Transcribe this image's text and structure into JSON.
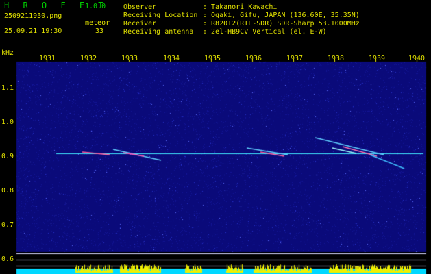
{
  "header": {
    "app_name": "H R O F F T",
    "app_version": "1.0.0",
    "file_name": "2509211930.png",
    "datetime": "25.09.21 19:30",
    "meteor_label": "meteor",
    "meteor_count": "33"
  },
  "info": [
    {
      "label": "Observer",
      "value": ": Takanori Kawachi"
    },
    {
      "label": "Receiving Location",
      "value": ": Ogaki, Gifu, JAPAN (136.60E, 35.35N)"
    },
    {
      "label": "Receiver",
      "value": ": R820T2(RTL-SDR) SDR-Sharp 53.1000MHz"
    },
    {
      "label": "Receiving antenna",
      "value": ": 2el-HB9CV Vertical (el. E-W)"
    }
  ],
  "axis": {
    "y_unit": "kHz",
    "x_ticks": [
      "1931",
      "1932",
      "1933",
      "1934",
      "1935",
      "1936",
      "1937",
      "1938",
      "1939",
      "1940"
    ],
    "y_ticks": [
      "1.1",
      "1.0",
      "0.9",
      "0.8",
      "0.7",
      "0.6"
    ]
  },
  "colors": {
    "background": "#000000",
    "text": "#e0e000",
    "title": "#00d000",
    "spectrum_base": "#0a0a7a",
    "carrier": "#40e8ff",
    "bottom_bar": "#00d8ff",
    "peak": "#f0f000"
  }
}
